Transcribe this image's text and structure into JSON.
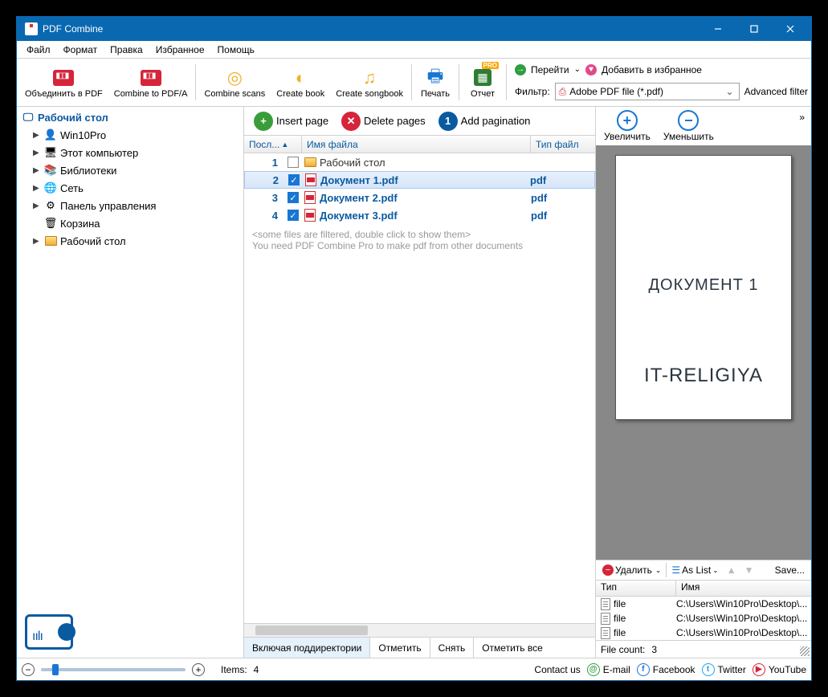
{
  "window": {
    "title": "PDF Combine"
  },
  "menu": {
    "file": "Файл",
    "format": "Формат",
    "edit": "Правка",
    "favorites": "Избранное",
    "help": "Помощь"
  },
  "toolbar": {
    "combine_pdf": "Объединить в PDF",
    "combine_pdfa": "Combine to PDF/A",
    "combine_scans": "Combine scans",
    "create_book": "Create book",
    "create_songbook": "Create songbook",
    "print": "Печать",
    "report": "Отчет",
    "pro": "PRO",
    "go": "Перейти",
    "add_fav": "Добавить в избранное",
    "filter_label": "Фильтр:",
    "filter_value": "Adobe PDF file (*.pdf)",
    "advanced": "Advanced filter"
  },
  "tree": {
    "root": "Рабочий стол",
    "items": [
      {
        "label": "Win10Pro",
        "icon": "user"
      },
      {
        "label": "Этот компьютер",
        "icon": "pc"
      },
      {
        "label": "Библиотеки",
        "icon": "lib"
      },
      {
        "label": "Сеть",
        "icon": "net"
      },
      {
        "label": "Панель управления",
        "icon": "cp"
      },
      {
        "label": "Корзина",
        "icon": "trash"
      },
      {
        "label": "Рабочий стол",
        "icon": "folder"
      }
    ]
  },
  "center_tools": {
    "insert": "Insert page",
    "delete": "Delete pages",
    "paginate": "Add pagination"
  },
  "columns": {
    "num": "Посл...",
    "name": "Имя файла",
    "type": "Тип файл"
  },
  "rows": [
    {
      "num": "1",
      "checked": false,
      "icon": "folder",
      "name": "Рабочий стол",
      "type": "",
      "sel": false,
      "folder": true
    },
    {
      "num": "2",
      "checked": true,
      "icon": "pdf",
      "name": "Документ 1.pdf",
      "type": "pdf",
      "sel": true,
      "folder": false
    },
    {
      "num": "3",
      "checked": true,
      "icon": "pdf",
      "name": "Документ 2.pdf",
      "type": "pdf",
      "sel": false,
      "folder": false
    },
    {
      "num": "4",
      "checked": true,
      "icon": "pdf",
      "name": "Документ 3.pdf",
      "type": "pdf",
      "sel": false,
      "folder": false
    }
  ],
  "hints": {
    "line1": "<some files are filtered, double click to show them>",
    "line2": "You need PDF Combine Pro to make pdf from other documents"
  },
  "bottom": {
    "subdir": "Включая поддиректории",
    "check": "Отметить",
    "uncheck": "Снять",
    "check_all": "Отметить все"
  },
  "zoom": {
    "in": "Увеличить",
    "out": "Уменьшить"
  },
  "preview": {
    "line1": "ДОКУМЕНТ 1",
    "line2": "IT-RELIGIYA"
  },
  "queue_tools": {
    "delete": "Удалить",
    "aslist": "As List",
    "save": "Save..."
  },
  "queue_cols": {
    "type": "Тип",
    "name": "Имя"
  },
  "queue": [
    {
      "type": "file",
      "name": "C:\\Users\\Win10Pro\\Desktop\\..."
    },
    {
      "type": "file",
      "name": "C:\\Users\\Win10Pro\\Desktop\\..."
    },
    {
      "type": "file",
      "name": "C:\\Users\\Win10Pro\\Desktop\\..."
    }
  ],
  "file_count": {
    "label": "File count:",
    "value": "3"
  },
  "status": {
    "items_label": "Items:",
    "items_value": "4",
    "contact": "Contact us",
    "email": "E-mail",
    "fb": "Facebook",
    "tw": "Twitter",
    "yt": "YouTube"
  }
}
